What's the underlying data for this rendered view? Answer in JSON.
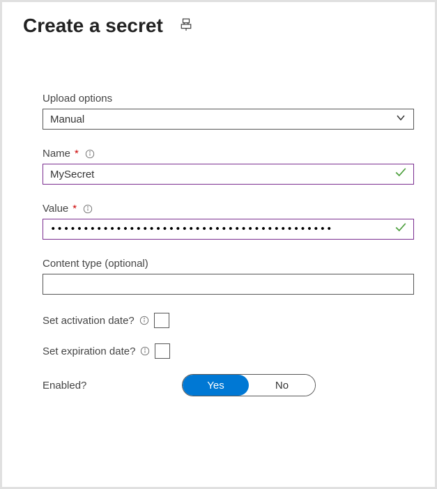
{
  "header": {
    "title": "Create a secret"
  },
  "form": {
    "upload_options": {
      "label": "Upload options",
      "value": "Manual"
    },
    "name": {
      "label": "Name",
      "required_mark": "*",
      "value": "MySecret"
    },
    "value": {
      "label": "Value",
      "required_mark": "*",
      "masked": "•••••••••••••••••••••••••••••••••••••••••••"
    },
    "content_type": {
      "label": "Content type (optional)",
      "value": ""
    },
    "activation": {
      "label": "Set activation date?"
    },
    "expiration": {
      "label": "Set expiration date?"
    },
    "enabled": {
      "label": "Enabled?",
      "yes": "Yes",
      "no": "No"
    }
  }
}
